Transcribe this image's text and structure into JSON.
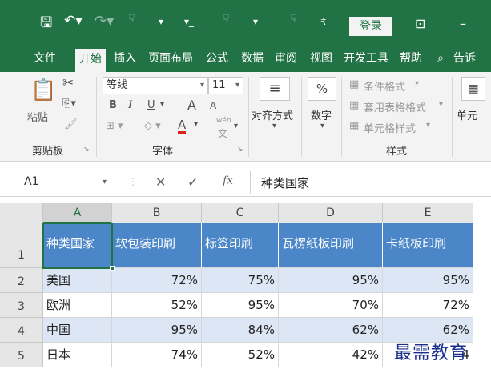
{
  "title_bar": {
    "login_button": "登录"
  },
  "tabs": [
    "文件",
    "开始",
    "插入",
    "页面布局",
    "公式",
    "数据",
    "审阅",
    "视图",
    "开发工具",
    "帮助",
    "告诉"
  ],
  "ribbon": {
    "clipboard": {
      "paste": "粘贴",
      "label": "剪贴板"
    },
    "font": {
      "name": "等线",
      "size": "11",
      "bold": "B",
      "italic": "I",
      "underline": "U",
      "grow": "A",
      "shrink": "A",
      "color_a": "A",
      "wen": "wén",
      "label": "字体"
    },
    "alignment": {
      "label": "对齐方式"
    },
    "number": {
      "symbol": "%",
      "label": "数字"
    },
    "styles": {
      "conditional": "条件格式",
      "table_format": "套用表格格式",
      "cell_styles": "单元格样式",
      "label": "样式"
    },
    "cells": {
      "label": "单元"
    }
  },
  "formula_bar": {
    "name_box": "A1",
    "fx": "fx",
    "content": "种类国家"
  },
  "sheet": {
    "columns": [
      "A",
      "B",
      "C",
      "D",
      "E"
    ],
    "rows": [
      "1",
      "2",
      "3",
      "4",
      "5"
    ],
    "header": [
      "种类国家",
      "软包装印刷",
      "标签印刷",
      "瓦楞纸板印刷",
      "卡纸板印刷"
    ],
    "data": [
      [
        "美国",
        "72%",
        "75%",
        "95%",
        "95%"
      ],
      [
        "欧洲",
        "52%",
        "95%",
        "70%",
        "72%"
      ],
      [
        "中国",
        "95%",
        "84%",
        "62%",
        "62%"
      ],
      [
        "日本",
        "74%",
        "52%",
        "42%",
        "4"
      ]
    ]
  },
  "watermark": "最需教育",
  "colors": {
    "excel_green": "#217346",
    "header_blue": "#4a86c8",
    "band_blue": "#dde6f4"
  }
}
